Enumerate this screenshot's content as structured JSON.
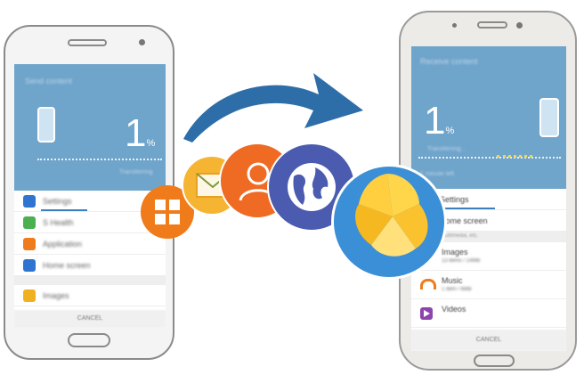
{
  "left_phone": {
    "header_title": "Send content",
    "percent_value": "1",
    "percent_symbol": "%",
    "status_sub": "Transferring",
    "items": [
      {
        "label": "Settings",
        "icon": "gear-icon",
        "color": "#2f74d0"
      },
      {
        "label": "S Health",
        "icon": "runner-icon",
        "color": "#4caf50"
      },
      {
        "label": "Application",
        "icon": "apps-icon",
        "color": "#f07b1a"
      },
      {
        "label": "Home screen",
        "icon": "home-icon",
        "color": "#2f74d0"
      },
      {
        "label": "Images",
        "icon": "gallery-icon",
        "color": "#f0b020"
      }
    ],
    "cancel_label": "CANCEL"
  },
  "right_phone": {
    "header_title": "Receive content",
    "percent_value": "1",
    "percent_symbol": "%",
    "status_sub": "Transferring...",
    "status_sub2": "1 minute left",
    "items": [
      {
        "label": "Settings",
        "icon": "gear-icon",
        "color": "#2f74d0"
      },
      {
        "label": "Home screen",
        "icon": "home-icon",
        "color": "#2f74d0"
      }
    ],
    "section_label": "Images, multimedia, etc.",
    "media_items": [
      {
        "label": "Images",
        "sub": "13 items / 14MB",
        "icon": "gallery-icon",
        "color": "#f0b020"
      },
      {
        "label": "Music",
        "sub": "1 item / 6MB",
        "icon": "headphones-icon",
        "color": "#f07b1a"
      },
      {
        "label": "Videos",
        "sub": "",
        "icon": "play-icon",
        "color": "#8e44ad"
      }
    ],
    "cancel_label": "CANCEL"
  },
  "transfer_icons": [
    {
      "name": "apps-icon",
      "color": "#f07b1a"
    },
    {
      "name": "email-icon",
      "color": "#f6b433"
    },
    {
      "name": "contacts-icon",
      "color": "#ef6a23"
    },
    {
      "name": "internet-icon",
      "color": "#4a5bb0"
    },
    {
      "name": "gallery-icon",
      "color": "#3a8fd6"
    }
  ],
  "arrow_color": "#2d6ea8"
}
